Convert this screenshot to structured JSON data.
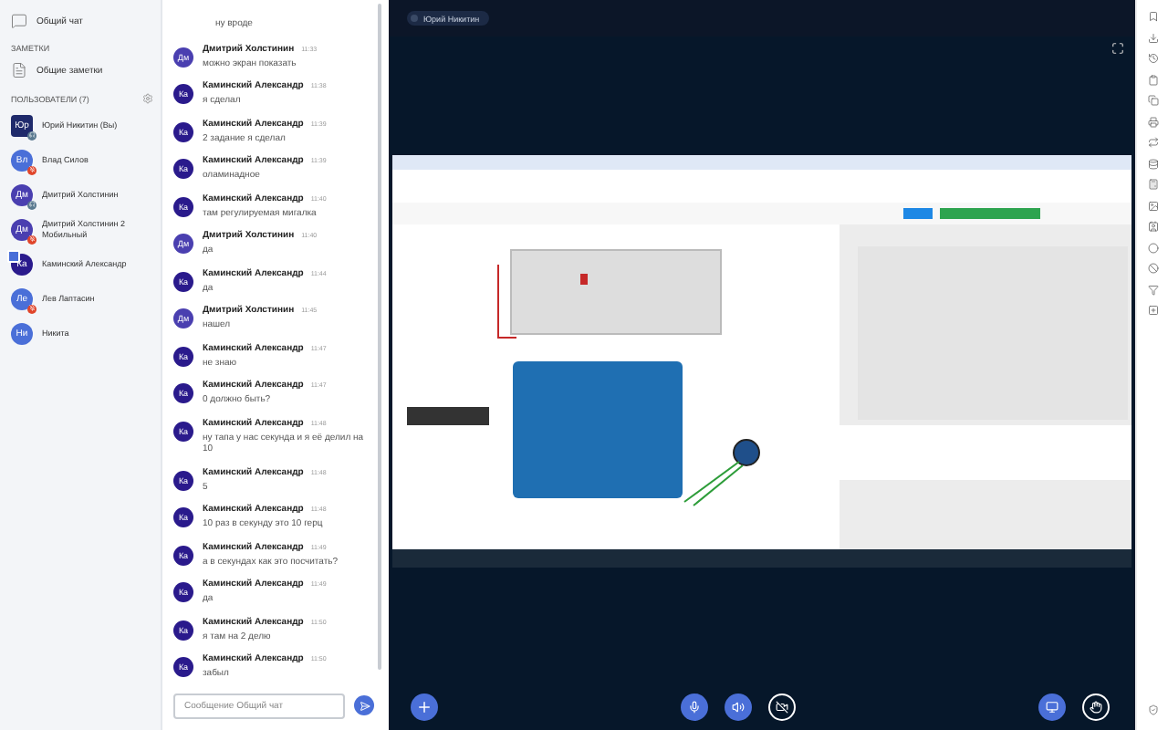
{
  "sidebar": {
    "chat": {
      "label": "Общий чат"
    },
    "notes_heading": "ЗАМЕТКИ",
    "notes": {
      "label": "Общие заметки"
    },
    "users_heading": "ПОЛЬЗОВАТЕЛИ (7)",
    "users": [
      {
        "initials": "Юр",
        "name": "Юрий Никитин (Вы)",
        "kind": "moderator",
        "muted": false,
        "listen_only": true,
        "color": "#1f2a6b"
      },
      {
        "initials": "Вл",
        "name": "Влад Силов",
        "kind": "viewer",
        "muted": true,
        "listen_only": false,
        "color": "#4a6fd8"
      },
      {
        "initials": "Дм",
        "name": "Дмитрий Холстинин",
        "kind": "viewer",
        "muted": false,
        "listen_only": true,
        "color": "#4a3fb0"
      },
      {
        "initials": "Дм",
        "name": "Дмитрий Холстинин 2 Мобильный",
        "kind": "viewer",
        "muted": true,
        "listen_only": false,
        "color": "#4a3fb0"
      },
      {
        "initials": "Ка",
        "name": "Каминский Александр",
        "kind": "presenter",
        "muted": false,
        "listen_only": false,
        "color": "#2a1a8c"
      },
      {
        "initials": "Ле",
        "name": "Лев Лаптасин",
        "kind": "viewer",
        "muted": true,
        "listen_only": false,
        "color": "#4a6fd8"
      },
      {
        "initials": "Ни",
        "name": "Никита",
        "kind": "viewer",
        "muted": false,
        "listen_only": false,
        "color": "#4a6fd8"
      }
    ]
  },
  "chat": {
    "first_partial": {
      "text": "ну вродe"
    },
    "messages": [
      {
        "initials": "Дм",
        "author": "Дмитрий Холстинин",
        "time": "11:33",
        "text": "можно экран показать",
        "color": "#4a3fb0"
      },
      {
        "initials": "Ка",
        "author": "Каминский Александр",
        "time": "11:38",
        "text": "я сделал",
        "color": "#2a1a8c"
      },
      {
        "initials": "Ка",
        "author": "Каминский Александр",
        "time": "11:39",
        "text": "2 задание я сделал",
        "color": "#2a1a8c"
      },
      {
        "initials": "Ка",
        "author": "Каминский Александр",
        "time": "11:39",
        "text": "оламинадное",
        "color": "#2a1a8c"
      },
      {
        "initials": "Ка",
        "author": "Каминский Александр",
        "time": "11:40",
        "text": "там регулируемая мигалка",
        "color": "#2a1a8c"
      },
      {
        "initials": "Дм",
        "author": "Дмитрий Холстинин",
        "time": "11:40",
        "text": "да",
        "color": "#4a3fb0"
      },
      {
        "initials": "Ка",
        "author": "Каминский Александр",
        "time": "11:44",
        "text": "да",
        "color": "#2a1a8c"
      },
      {
        "initials": "Дм",
        "author": "Дмитрий Холстинин",
        "time": "11:45",
        "text": "нашел",
        "color": "#4a3fb0"
      },
      {
        "initials": "Ка",
        "author": "Каминский Александр",
        "time": "11:47",
        "text": "не знаю",
        "color": "#2a1a8c"
      },
      {
        "initials": "Ка",
        "author": "Каминский Александр",
        "time": "11:47",
        "text": "0 должно быть?",
        "color": "#2a1a8c"
      },
      {
        "initials": "Ка",
        "author": "Каминский Александр",
        "time": "11:48",
        "text": "ну тапа у нас секунда и я её делил на 10",
        "color": "#2a1a8c"
      },
      {
        "initials": "Ка",
        "author": "Каминский Александр",
        "time": "11:48",
        "text": "5",
        "color": "#2a1a8c"
      },
      {
        "initials": "Ка",
        "author": "Каминский Александр",
        "time": "11:48",
        "text": "10 раз в секунду это 10 герц",
        "color": "#2a1a8c"
      },
      {
        "initials": "Ка",
        "author": "Каминский Александр",
        "time": "11:49",
        "text": "а в секундах как это посчитать?",
        "color": "#2a1a8c"
      },
      {
        "initials": "Ка",
        "author": "Каминский Александр",
        "time": "11:49",
        "text": "да",
        "color": "#2a1a8c"
      },
      {
        "initials": "Ка",
        "author": "Каминский Александр",
        "time": "11:50",
        "text": "я там на 2 делю",
        "color": "#2a1a8c"
      },
      {
        "initials": "Ка",
        "author": "Каминский Александр",
        "time": "11:50",
        "text": "забыл",
        "color": "#2a1a8c"
      }
    ],
    "input": {
      "placeholder": "Сообщение Общий чат"
    }
  },
  "video": {
    "presenter_label": "Юрий Никитин"
  }
}
